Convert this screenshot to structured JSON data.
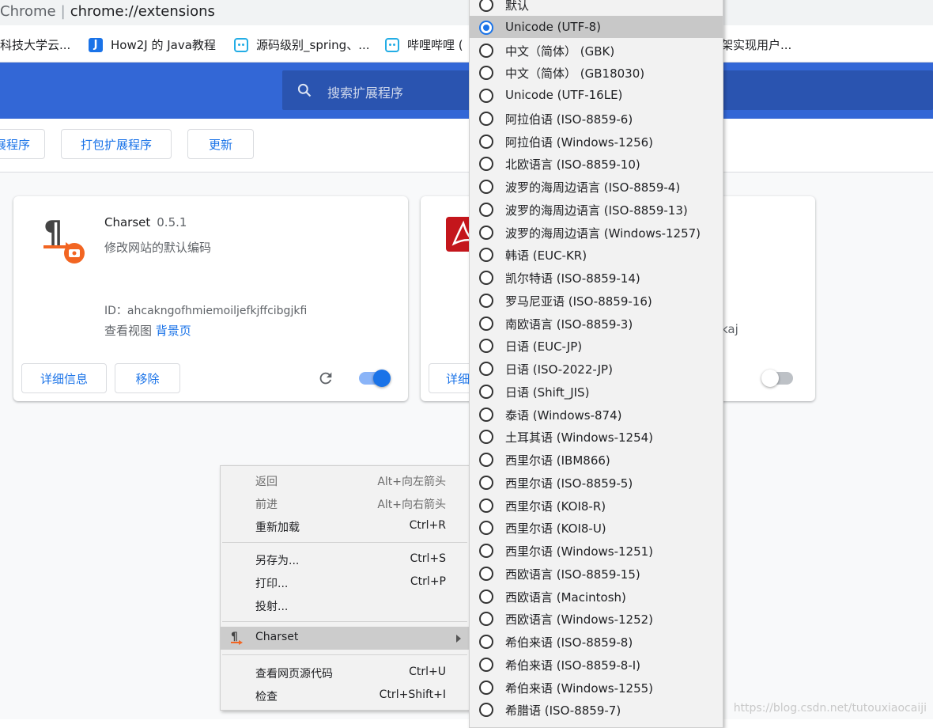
{
  "omnibox": {
    "scheme": "Chrome",
    "url": "chrome://extensions"
  },
  "bookmarks": [
    {
      "label": "科技大学云...",
      "icon": "none"
    },
    {
      "label": "How2J 的 Java教程",
      "icon": "j-icon"
    },
    {
      "label": "源码级别_spring、...",
      "icon": "bilibili-icon"
    },
    {
      "label": "哔哩哔哩 (",
      "icon": "bilibili-icon"
    },
    {
      "label": "架实现用户...",
      "icon": "none"
    }
  ],
  "header": {
    "search_placeholder": "搜索扩展程序"
  },
  "toolbar": {
    "load_unpacked": "展程序",
    "pack": "打包扩展程序",
    "update": "更新"
  },
  "cards": [
    {
      "name": "Charset",
      "version": "0.5.1",
      "description": "修改网站的默认编码",
      "id_label": "ID：",
      "id_value": "ahcakngofhmiemoiljefkjffcibgjkfi",
      "views_label": "查看视图",
      "views_link": "背景页",
      "details": "详细信息",
      "remove": "移除",
      "enabled": true
    },
    {
      "name": "",
      "id_tail": "kaj",
      "details": "详细",
      "enabled": false
    }
  ],
  "context_menu": {
    "items": [
      {
        "label": "返回",
        "shortcut": "Alt+向左箭头",
        "disabled": true
      },
      {
        "label": "前进",
        "shortcut": "Alt+向右箭头",
        "disabled": true
      },
      {
        "label": "重新加载",
        "shortcut": "Ctrl+R",
        "disabled": false
      },
      {
        "label": "另存为...",
        "shortcut": "Ctrl+S",
        "disabled": false
      },
      {
        "label": "打印...",
        "shortcut": "Ctrl+P",
        "disabled": false
      },
      {
        "label": "投射...",
        "shortcut": "",
        "disabled": false
      },
      {
        "label": "Charset",
        "shortcut": "",
        "disabled": false,
        "highlighted": true,
        "submenu": true
      },
      {
        "label": "查看网页源代码",
        "shortcut": "Ctrl+U",
        "disabled": false
      },
      {
        "label": "检查",
        "shortcut": "Ctrl+Shift+I",
        "disabled": false
      }
    ]
  },
  "charset_submenu": {
    "selected": "Unicode (UTF-8)",
    "items": [
      "默认",
      "Unicode (UTF-8)",
      "中文（简体） (GBK)",
      "中文（简体） (GB18030)",
      "Unicode (UTF-16LE)",
      "阿拉伯语 (ISO-8859-6)",
      "阿拉伯语 (Windows-1256)",
      "北欧语言 (ISO-8859-10)",
      "波罗的海周边语言 (ISO-8859-4)",
      "波罗的海周边语言 (ISO-8859-13)",
      "波罗的海周边语言 (Windows-1257)",
      "韩语 (EUC-KR)",
      "凯尔特语 (ISO-8859-14)",
      "罗马尼亚语 (ISO-8859-16)",
      "南欧语言 (ISO-8859-3)",
      "日语 (EUC-JP)",
      "日语 (ISO-2022-JP)",
      "日语 (Shift_JIS)",
      "泰语 (Windows-874)",
      "土耳其语 (Windows-1254)",
      "西里尔语 (IBM866)",
      "西里尔语 (ISO-8859-5)",
      "西里尔语 (KOI8-R)",
      "西里尔语 (KOI8-U)",
      "西里尔语 (Windows-1251)",
      "西欧语言 (ISO-8859-15)",
      "西欧语言 (Macintosh)",
      "西欧语言 (Windows-1252)",
      "希伯来语 (ISO-8859-8)",
      "希伯来语 (ISO-8859-8-I)",
      "希伯来语 (Windows-1255)",
      "希腊语 (ISO-8859-7)"
    ]
  },
  "watermark": "https://blog.csdn.net/tutouxiaocaiji",
  "colors": {
    "header": "#3367d6",
    "accent": "#1a73e8",
    "charset_icon_orange": "#f26522",
    "pdf_red": "#c4161c"
  }
}
